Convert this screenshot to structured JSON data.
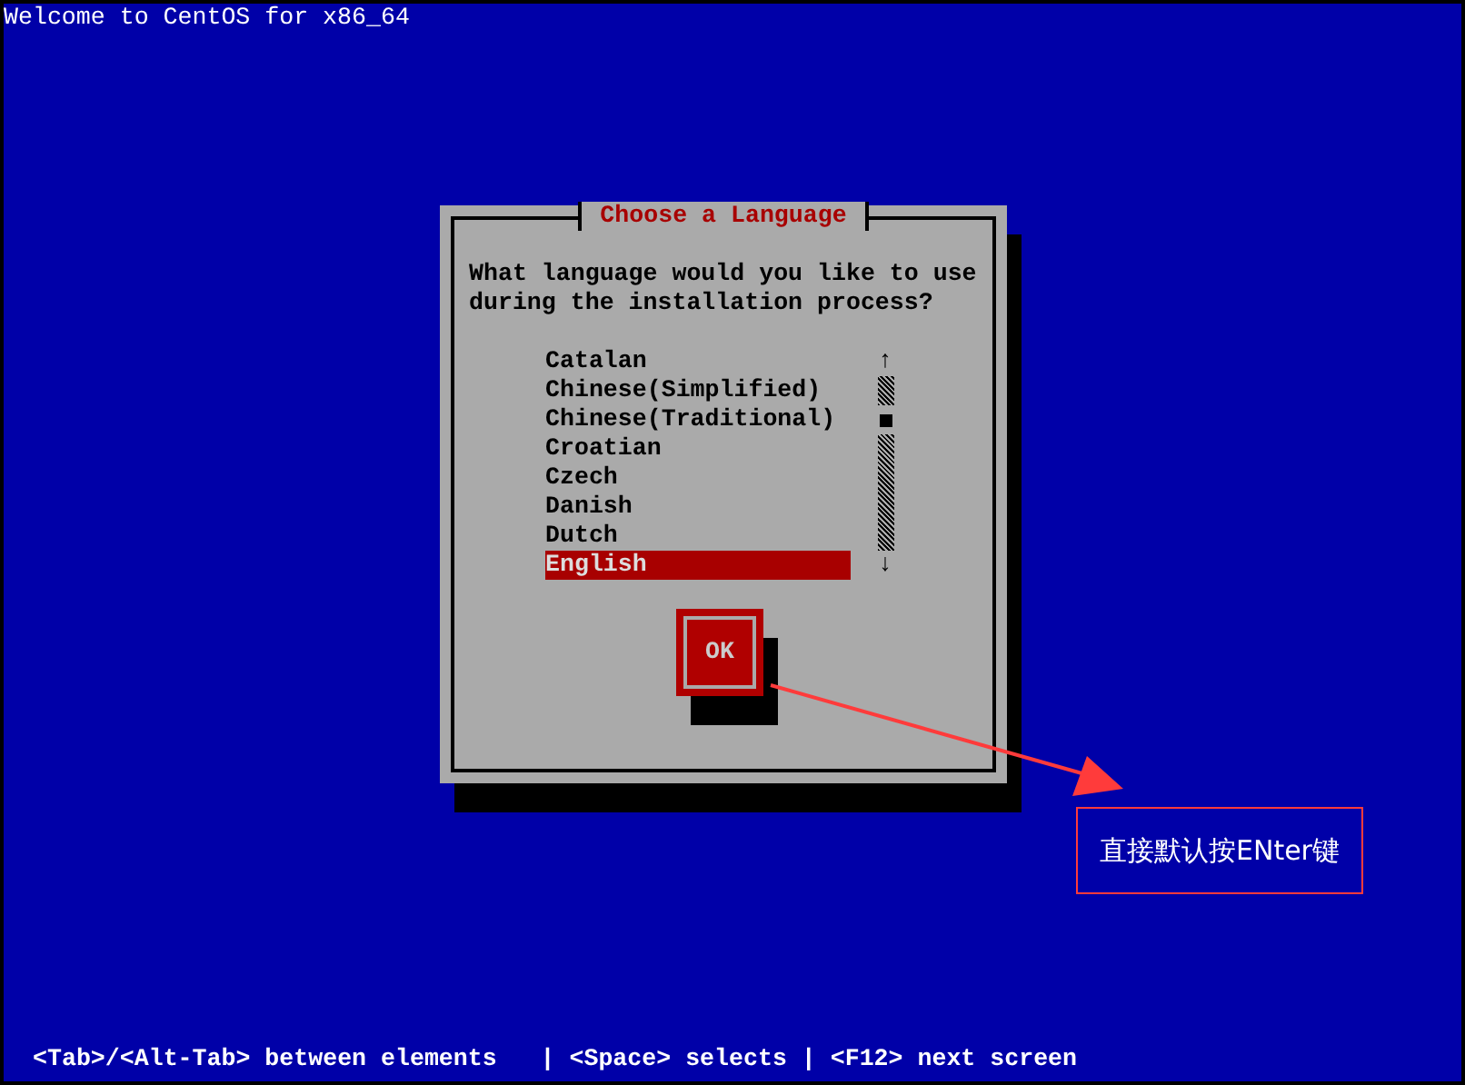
{
  "screen_title": "Welcome to CentOS for x86_64",
  "dialog": {
    "title": "Choose a Language",
    "prompt": "What language would you like to use during the installation process?",
    "languages": [
      {
        "label": "Catalan",
        "selected": false
      },
      {
        "label": "Chinese(Simplified)",
        "selected": false
      },
      {
        "label": "Chinese(Traditional)",
        "selected": false
      },
      {
        "label": "Croatian",
        "selected": false
      },
      {
        "label": "Czech",
        "selected": false
      },
      {
        "label": "Danish",
        "selected": false
      },
      {
        "label": "Dutch",
        "selected": false
      },
      {
        "label": "English",
        "selected": true
      }
    ],
    "scroll_up": "↑",
    "scroll_down": "↓",
    "ok_button": "OK"
  },
  "annotation": {
    "text": "直接默认按ENter键"
  },
  "status_bar": "<Tab>/<Alt-Tab> between elements   | <Space> selects | <F12> next screen"
}
